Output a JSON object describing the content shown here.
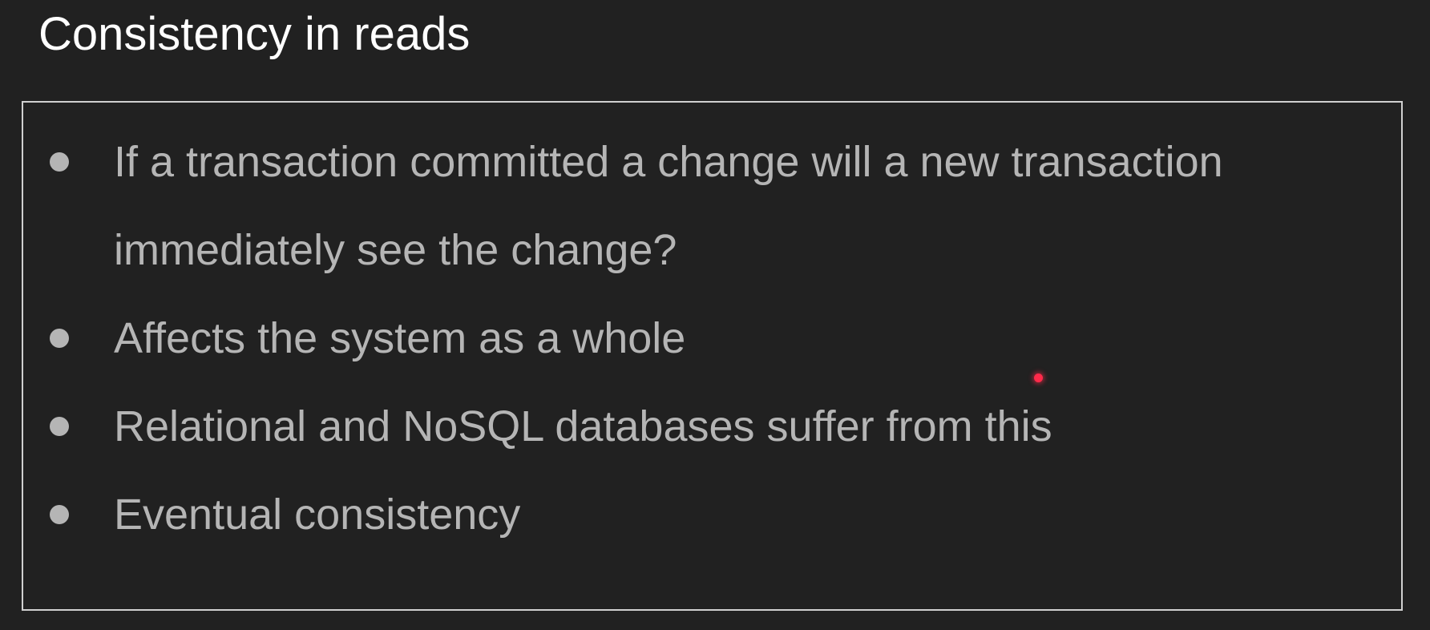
{
  "slide": {
    "title": "Consistency in reads",
    "bullets": [
      "If a transaction committed a change will a new transaction immediately see the change?",
      "Affects the system as a whole",
      "Relational and NoSQL databases suffer from this",
      "Eventual consistency"
    ]
  },
  "colors": {
    "background": "#212121",
    "title_text": "#ffffff",
    "bullet_text": "#b5b5b5",
    "box_border": "#d0d0d0",
    "pointer": "#ff2a4a"
  }
}
